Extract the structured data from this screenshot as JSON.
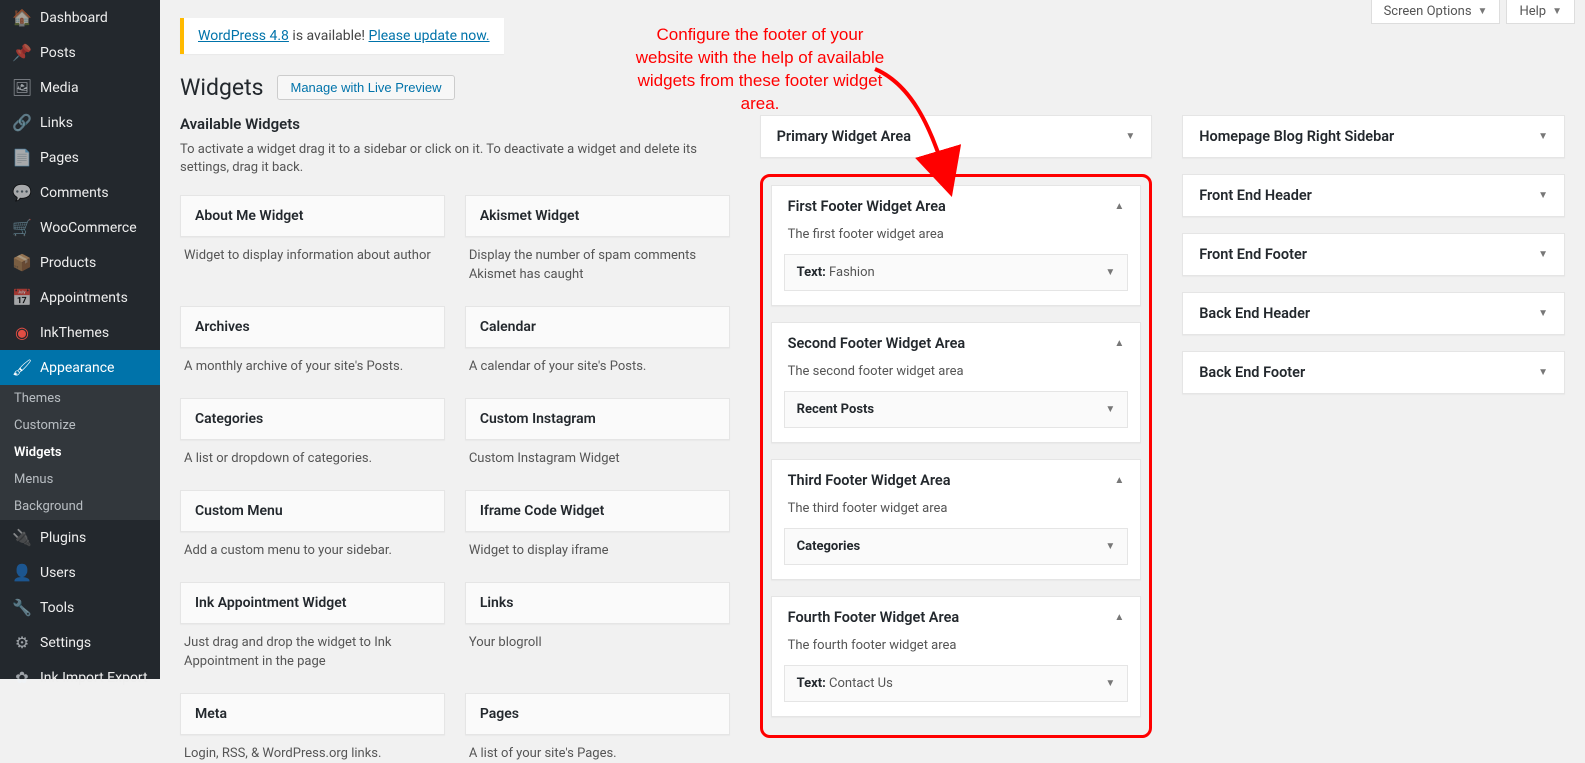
{
  "top": {
    "screen_options": "Screen Options",
    "help": "Help"
  },
  "sidebar": {
    "items": [
      {
        "icon": "🏠",
        "label": "Dashboard"
      },
      {
        "icon": "📌",
        "label": "Posts"
      },
      {
        "icon": "🖼",
        "label": "Media"
      },
      {
        "icon": "🔗",
        "label": "Links"
      },
      {
        "icon": "📄",
        "label": "Pages"
      },
      {
        "icon": "💬",
        "label": "Comments"
      },
      {
        "icon": "🛒",
        "label": "WooCommerce"
      },
      {
        "icon": "📦",
        "label": "Products"
      },
      {
        "icon": "📅",
        "label": "Appointments"
      },
      {
        "icon": "◉",
        "label": "InkThemes",
        "ink": true
      },
      {
        "icon": "🖌",
        "label": "Appearance",
        "current": true
      },
      {
        "icon": "🔌",
        "label": "Plugins"
      },
      {
        "icon": "👤",
        "label": "Users"
      },
      {
        "icon": "🔧",
        "label": "Tools"
      },
      {
        "icon": "⚙",
        "label": "Settings"
      },
      {
        "icon": "✿",
        "label": "Ink Import Export"
      }
    ],
    "submenu": [
      {
        "label": "Themes"
      },
      {
        "label": "Customize"
      },
      {
        "label": "Widgets",
        "current": true
      },
      {
        "label": "Menus"
      },
      {
        "label": "Background"
      }
    ]
  },
  "nag": {
    "prefix": "WordPress 4.8",
    "mid": " is available! ",
    "link": "Please update now."
  },
  "heading": {
    "title": "Widgets",
    "preview_btn": "Manage with Live Preview"
  },
  "annotation_text": "Configure the footer of your website with the help of available widgets from these footer widget area.",
  "available": {
    "title": "Available Widgets",
    "desc": "To activate a widget drag it to a sidebar or click on it. To deactivate a widget and delete its settings, drag it back.",
    "widgets": [
      {
        "name": "About Me Widget",
        "desc": "Widget to display information about author"
      },
      {
        "name": "Akismet Widget",
        "desc": "Display the number of spam comments Akismet has caught"
      },
      {
        "name": "Archives",
        "desc": "A monthly archive of your site's Posts."
      },
      {
        "name": "Calendar",
        "desc": "A calendar of your site's Posts."
      },
      {
        "name": "Categories",
        "desc": "A list or dropdown of categories."
      },
      {
        "name": "Custom Instagram",
        "desc": "Custom Instagram Widget"
      },
      {
        "name": "Custom Menu",
        "desc": "Add a custom menu to your sidebar."
      },
      {
        "name": "Iframe Code Widget",
        "desc": "Widget to display iframe"
      },
      {
        "name": "Ink Appointment Widget",
        "desc": "Just drag and drop the widget to Ink Appointment in the page"
      },
      {
        "name": "Links",
        "desc": "Your blogroll"
      },
      {
        "name": "Meta",
        "desc": "Login, RSS, & WordPress.org links."
      },
      {
        "name": "Pages",
        "desc": "A list of your site's Pages."
      }
    ]
  },
  "areas_mid": {
    "primary": {
      "title": "Primary Widget Area"
    },
    "footer": [
      {
        "title": "First Footer Widget Area",
        "desc": "The first footer widget area",
        "widget_label": "Text:",
        "widget_value": " Fashion"
      },
      {
        "title": "Second Footer Widget Area",
        "desc": "The second footer widget area",
        "widget_label": "Recent Posts",
        "widget_value": ""
      },
      {
        "title": "Third Footer Widget Area",
        "desc": "The third footer widget area",
        "widget_label": "Categories",
        "widget_value": ""
      },
      {
        "title": "Fourth Footer Widget Area",
        "desc": "The fourth footer widget area",
        "widget_label": "Text:",
        "widget_value": " Contact Us"
      }
    ]
  },
  "areas_right": [
    {
      "title": "Homepage Blog Right Sidebar"
    },
    {
      "title": "Front End Header"
    },
    {
      "title": "Front End Footer"
    },
    {
      "title": "Back End Header"
    },
    {
      "title": "Back End Footer"
    }
  ]
}
